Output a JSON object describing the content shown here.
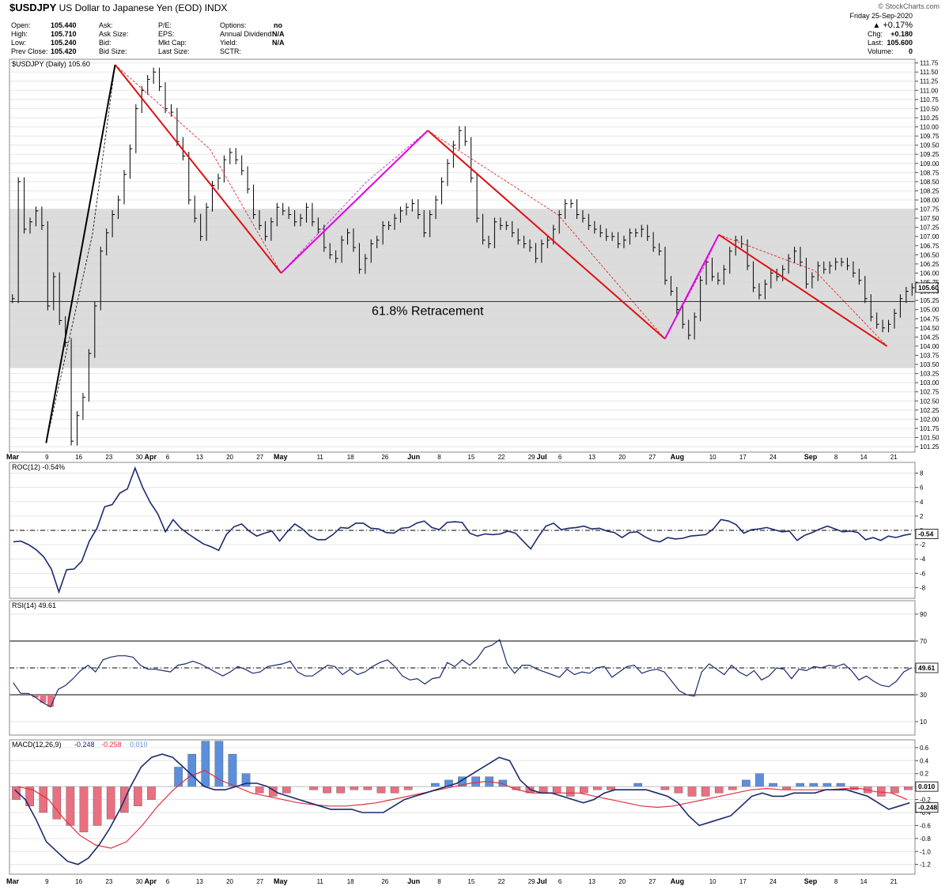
{
  "header": {
    "symbol": "$USDJPY",
    "name": "US Dollar to Japanese Yen (EOD)",
    "exchange": "INDX",
    "logo": "© StockCharts.com",
    "date": "Friday  25-Sep-2020",
    "change_pct": "+0.17%",
    "quote_left": [
      {
        "label": "Open:",
        "value": "105.440"
      },
      {
        "label": "High:",
        "value": "105.710"
      },
      {
        "label": "Low:",
        "value": "105.240"
      },
      {
        "label": "Prev Close:",
        "value": "105.420"
      }
    ],
    "quote_mid": [
      "Ask:",
      "Ask Size:",
      "Bid:",
      "Bid Size:"
    ],
    "quote_mid2": [
      "P/E:",
      "EPS:",
      "Mkt Cap:",
      "Last Size:"
    ],
    "quote_right": [
      {
        "label": "Options:",
        "value": "no"
      },
      {
        "label": "Annual Dividend:",
        "value": "N/A"
      },
      {
        "label": "Yield:",
        "value": "N/A"
      },
      {
        "label": "SCTR:",
        "value": ""
      }
    ],
    "quote_far": [
      {
        "label": "Chg:",
        "value": "+0.180"
      },
      {
        "label": "Last:",
        "value": "105.600"
      },
      {
        "label": "Volume:",
        "value": "0"
      }
    ]
  },
  "chart_data": [
    {
      "type": "line",
      "panel": "price",
      "title": "$USDJPY (Daily) 105.60",
      "ylim": [
        101.1,
        111.85
      ],
      "yticks": [
        "101.25",
        "101.50",
        "101.75",
        "102.00",
        "102.25",
        "102.50",
        "102.75",
        "103.00",
        "103.25",
        "103.50",
        "103.75",
        "104.00",
        "104.25",
        "104.50",
        "104.75",
        "105.00",
        "105.25",
        "105.50",
        "105.75",
        "106.00",
        "106.25",
        "106.50",
        "106.75",
        "107.00",
        "107.25",
        "107.50",
        "107.75",
        "108.00",
        "108.25",
        "108.50",
        "108.75",
        "109.00",
        "109.25",
        "109.50",
        "109.75",
        "110.00",
        "110.25",
        "110.50",
        "110.75",
        "111.00",
        "111.25",
        "111.50",
        "111.75"
      ],
      "last_label": "105.60",
      "annotation": "61.8% Retracement",
      "retracement_level": 105.22,
      "band": [
        103.4,
        107.75
      ],
      "x_day_range": [
        60,
        270
      ],
      "month_ticks": [
        {
          "label": "Mar",
          "day": 60
        },
        {
          "label": "Apr",
          "day": 92
        },
        {
          "label": "May",
          "day": 122
        },
        {
          "label": "Jun",
          "day": 153
        },
        {
          "label": "Jul",
          "day": 183
        },
        {
          "label": "Aug",
          "day": 214
        },
        {
          "label": "Sep",
          "day": 245
        }
      ],
      "day_ticks": [
        {
          "label": "9",
          "day": 69
        },
        {
          "label": "16",
          "day": 76
        },
        {
          "label": "23",
          "day": 83
        },
        {
          "label": "30",
          "day": 90
        },
        {
          "label": "6",
          "day": 97
        },
        {
          "label": "13",
          "day": 104
        },
        {
          "label": "20",
          "day": 111
        },
        {
          "label": "27",
          "day": 118
        },
        {
          "label": "11",
          "day": 132
        },
        {
          "label": "18",
          "day": 139
        },
        {
          "label": "26",
          "day": 147
        },
        {
          "label": "8",
          "day": 160
        },
        {
          "label": "15",
          "day": 167
        },
        {
          "label": "22",
          "day": 174
        },
        {
          "label": "29",
          "day": 181
        },
        {
          "label": "6",
          "day": 188
        },
        {
          "label": "13",
          "day": 195
        },
        {
          "label": "20",
          "day": 202
        },
        {
          "label": "27",
          "day": 209
        },
        {
          "label": "10",
          "day": 223
        },
        {
          "label": "17",
          "day": 230
        },
        {
          "label": "24",
          "day": 237
        },
        {
          "label": "8",
          "day": 252
        },
        {
          "label": "14",
          "day": 258
        },
        {
          "label": "21",
          "day": 265
        }
      ],
      "series": [
        {
          "values": [
            105.3,
            108.5,
            107.2,
            107.4,
            107.7,
            107.3,
            105.1,
            105.9,
            104.7,
            104.1,
            101.4,
            102.1,
            102.6,
            103.8,
            105.1,
            106.6,
            107.1,
            107.6,
            108.0,
            108.7,
            109.4,
            110.5,
            111.0,
            111.3,
            111.5,
            111.1,
            110.5,
            110.4,
            109.6,
            109.2,
            108.0,
            107.5,
            107.0,
            107.8,
            108.4,
            108.6,
            109.1,
            109.3,
            109.1,
            108.8,
            108.3,
            107.6,
            107.3,
            107.0,
            107.4,
            107.8,
            107.7,
            107.6,
            107.4,
            107.5,
            107.8,
            107.4,
            107.2,
            106.7,
            106.5,
            106.4,
            106.9,
            107.1,
            106.7,
            106.1,
            106.4,
            106.8,
            106.9,
            107.3,
            107.3,
            107.5,
            107.7,
            107.8,
            107.9,
            107.6,
            107.1,
            107.6,
            108.0,
            108.5,
            109.0,
            109.5,
            109.9,
            109.6,
            108.6,
            107.5,
            106.9,
            106.8,
            107.4,
            107.3,
            107.3,
            107.1,
            106.9,
            106.8,
            106.7,
            106.4,
            106.8,
            106.9,
            107.2,
            107.6,
            107.9,
            107.9,
            107.6,
            107.5,
            107.3,
            107.2,
            107.1,
            107.0,
            107.0,
            106.8,
            106.9,
            107.1,
            107.1,
            107.2,
            107.0,
            106.7,
            106.6,
            105.8,
            105.5,
            105.0,
            104.6,
            104.3,
            104.8,
            105.8,
            106.3,
            105.9,
            105.8,
            106.1,
            106.6,
            106.9,
            106.8,
            106.2,
            105.6,
            105.4,
            105.7,
            106.0,
            105.9,
            106.1,
            106.4,
            106.6,
            106.3,
            105.7,
            105.9,
            106.2,
            106.1,
            106.2,
            106.3,
            106.3,
            106.2,
            106.0,
            105.8,
            105.3,
            104.8,
            104.6,
            104.5,
            104.6,
            104.9,
            105.3,
            105.5,
            105.6
          ],
          "color": "#000000"
        }
      ],
      "trendlines": [
        {
          "from": [
            68.5,
            101.35
          ],
          "to": [
            84.5,
            111.7
          ],
          "color": "#000000"
        },
        {
          "from": [
            84.5,
            111.7
          ],
          "to": [
            123,
            106.0
          ],
          "color": "#e01010"
        },
        {
          "from": [
            123,
            106.0
          ],
          "to": [
            157,
            109.9
          ],
          "color": "#e000e0"
        },
        {
          "from": [
            157,
            109.9
          ],
          "to": [
            212,
            104.2
          ],
          "color": "#e01010"
        },
        {
          "from": [
            212,
            104.2
          ],
          "to": [
            224.5,
            107.05
          ],
          "color": "#e000e0"
        },
        {
          "from": [
            224.5,
            107.05
          ],
          "to": [
            263.5,
            104.0
          ],
          "color": "#e01010"
        }
      ]
    },
    {
      "type": "line",
      "panel": "roc",
      "title": "ROC(12) -0.54%",
      "ylim": [
        -9.5,
        9.5
      ],
      "yticks": [
        "8",
        "6",
        "4",
        "2",
        "0",
        "-2",
        "-4",
        "-6",
        "-8"
      ],
      "last_label": "-0.54",
      "reference": 0,
      "series": [
        {
          "name": "ROC(12)",
          "values": [
            -1.6,
            -1.5,
            -2.0,
            -2.7,
            -3.7,
            -5.4,
            -8.6,
            -5.5,
            -5.4,
            -4.3,
            -1.5,
            0.3,
            3.3,
            3.6,
            5.2,
            5.8,
            8.7,
            6.0,
            3.9,
            2.3,
            -0.2,
            1.5,
            0.3,
            -0.5,
            -1.2,
            -1.9,
            -2.3,
            -2.8,
            -0.6,
            0.5,
            0.9,
            -0.1,
            -0.8,
            -0.4,
            -0.1,
            -1.5,
            -0.2,
            0.9,
            0.2,
            -0.8,
            -1.3,
            -1.3,
            -0.6,
            0.4,
            0.3,
            1.0,
            1.0,
            0.3,
            0.2,
            -0.3,
            -0.4,
            0.3,
            0.4,
            1.0,
            1.3,
            0.4,
            0.1,
            1.1,
            1.2,
            1.1,
            -0.4,
            -0.8,
            -0.5,
            -0.6,
            -0.5,
            -0.1,
            -0.4,
            -1.5,
            -2.6,
            -0.9,
            0.6,
            1.0,
            0.1,
            0.3,
            0.4,
            0.6,
            0.2,
            0.3,
            -0.1,
            -0.3,
            -1.0,
            -0.3,
            -0.2,
            -0.9,
            -1.4,
            -1.6,
            -1.0,
            -1.2,
            -1.1,
            -0.8,
            -0.7,
            -0.6,
            0.2,
            1.5,
            1.3,
            0.8,
            -0.4,
            0.1,
            0.2,
            0.4,
            0.1,
            -0.2,
            -0.1,
            -1.4,
            -0.7,
            -0.3,
            0.2,
            0.6,
            0.2,
            -0.2,
            -0.1,
            -0.3,
            -1.3,
            -1.0,
            -1.4,
            -0.8,
            -1.0,
            -0.7,
            -0.5
          ]
        }
      ]
    },
    {
      "type": "line",
      "panel": "rsi",
      "title": "RSI(14) 49.61",
      "ylim": [
        0,
        100
      ],
      "yticks": [
        "90",
        "70",
        "50",
        "30",
        "10"
      ],
      "last_label": "49.61",
      "levels": [
        70,
        50,
        30
      ],
      "series": [
        {
          "name": "RSI(14)",
          "values": [
            39,
            31,
            31,
            28,
            24,
            21,
            34,
            37,
            42,
            48,
            52,
            47,
            56,
            58,
            59,
            59,
            58,
            52,
            49,
            49,
            48,
            47,
            52,
            53,
            55,
            53,
            50,
            47,
            44,
            47,
            51,
            49,
            46,
            47,
            51,
            52,
            53,
            55,
            47,
            44,
            44,
            48,
            52,
            51,
            45,
            49,
            45,
            47,
            51,
            54,
            56,
            51,
            44,
            41,
            42,
            38,
            42,
            43,
            54,
            51,
            56,
            52,
            57,
            65,
            67,
            71,
            53,
            46,
            52,
            52,
            49,
            47,
            45,
            43,
            49,
            45,
            47,
            46,
            50,
            51,
            43,
            47,
            51,
            52,
            46,
            48,
            49,
            47,
            40,
            33,
            30,
            29,
            47,
            53,
            49,
            45,
            52,
            47,
            44,
            48,
            41,
            44,
            50,
            49,
            42,
            49,
            48,
            51,
            50,
            52,
            51,
            53,
            48,
            41,
            44,
            40,
            37,
            36,
            40,
            47,
            50
          ]
        }
      ]
    },
    {
      "type": "line",
      "panel": "macd",
      "title": "MACD(12,26,9)",
      "values_label": [
        "-0.248",
        "-0.258",
        "0.010"
      ],
      "ylim": [
        -1.35,
        0.72
      ],
      "yticks": [
        "0.6",
        "0.4",
        "0.2",
        "0.0",
        "-0.2",
        "-0.4",
        "-0.6",
        "-0.8",
        "-1.0",
        "-1.2"
      ],
      "last_labels": [
        "0.010",
        "-0.248"
      ],
      "series": [
        {
          "name": "MACD",
          "values": [
            -0.05,
            -0.2,
            -0.5,
            -0.85,
            -1.0,
            -1.15,
            -1.2,
            -1.1,
            -0.9,
            -0.65,
            -0.35,
            0.0,
            0.3,
            0.45,
            0.5,
            0.45,
            0.3,
            0.15,
            0.0,
            -0.05,
            -0.05,
            0.0,
            0.05,
            0.05,
            0.0,
            -0.1,
            -0.15,
            -0.2,
            -0.25,
            -0.3,
            -0.35,
            -0.35,
            -0.35,
            -0.4,
            -0.4,
            -0.4,
            -0.3,
            -0.2,
            -0.15,
            -0.1,
            -0.05,
            0.0,
            0.05,
            0.15,
            0.25,
            0.35,
            0.45,
            0.4,
            0.1,
            -0.05,
            -0.1,
            -0.1,
            -0.15,
            -0.2,
            -0.25,
            -0.2,
            -0.1,
            -0.05,
            -0.05,
            -0.05,
            -0.05,
            -0.1,
            -0.15,
            -0.25,
            -0.45,
            -0.6,
            -0.55,
            -0.5,
            -0.45,
            -0.3,
            -0.15,
            -0.1,
            -0.15,
            -0.15,
            -0.1,
            -0.1,
            -0.1,
            -0.05,
            -0.05,
            -0.05,
            -0.1,
            -0.15,
            -0.25,
            -0.35,
            -0.3,
            -0.25
          ]
        },
        {
          "name": "Signal",
          "values": [
            0.0,
            -0.05,
            -0.2,
            -0.5,
            -0.75,
            -0.9,
            -0.95,
            -0.85,
            -0.6,
            -0.3,
            -0.05,
            0.15,
            0.25,
            0.1,
            0.0,
            -0.1,
            -0.15,
            -0.2,
            -0.25,
            -0.28,
            -0.3,
            -0.3,
            -0.28,
            -0.25,
            -0.2,
            -0.15,
            -0.1,
            -0.05,
            0.0,
            0.05,
            0.08,
            0.05,
            -0.05,
            -0.1,
            -0.1,
            -0.1,
            -0.1,
            -0.15,
            -0.2,
            -0.25,
            -0.3,
            -0.32,
            -0.3,
            -0.25,
            -0.2,
            -0.15,
            -0.1,
            -0.05,
            -0.03,
            -0.05,
            -0.05,
            -0.05,
            -0.05,
            -0.03,
            -0.03,
            -0.08,
            -0.1,
            -0.2
          ]
        },
        {
          "name": "Histogram",
          "values": [
            -0.2,
            -0.3,
            -0.4,
            -0.5,
            -0.6,
            -0.7,
            -0.6,
            -0.5,
            -0.4,
            -0.3,
            -0.2,
            0.0,
            0.3,
            0.5,
            0.7,
            0.7,
            0.5,
            0.2,
            -0.1,
            -0.15,
            -0.1,
            0.0,
            -0.05,
            -0.1,
            -0.1,
            -0.05,
            -0.05,
            -0.1,
            -0.1,
            -0.05,
            0.0,
            0.05,
            0.1,
            0.15,
            0.15,
            0.15,
            0.1,
            -0.05,
            -0.1,
            -0.1,
            -0.1,
            -0.15,
            -0.1,
            -0.05,
            -0.05,
            0.0,
            0.05,
            0.0,
            -0.05,
            -0.1,
            -0.15,
            -0.15,
            -0.1,
            -0.05,
            0.1,
            0.2,
            0.05,
            -0.05,
            0.05,
            0.05,
            0.05,
            0.05,
            -0.05,
            -0.1,
            -0.15,
            -0.1,
            -0.05
          ]
        }
      ],
      "colors": {
        "macd": "#1a2a6c",
        "signal": "#e03040",
        "hist_pos": "#5b8fdc",
        "hist_neg": "#e87080"
      }
    }
  ],
  "colors": {
    "line": "#1a2a6c",
    "band": "#d6d6d6",
    "grid": "#e6e6e6",
    "up_arrow": "#333333",
    "rsi_oversold": "#e87080"
  }
}
